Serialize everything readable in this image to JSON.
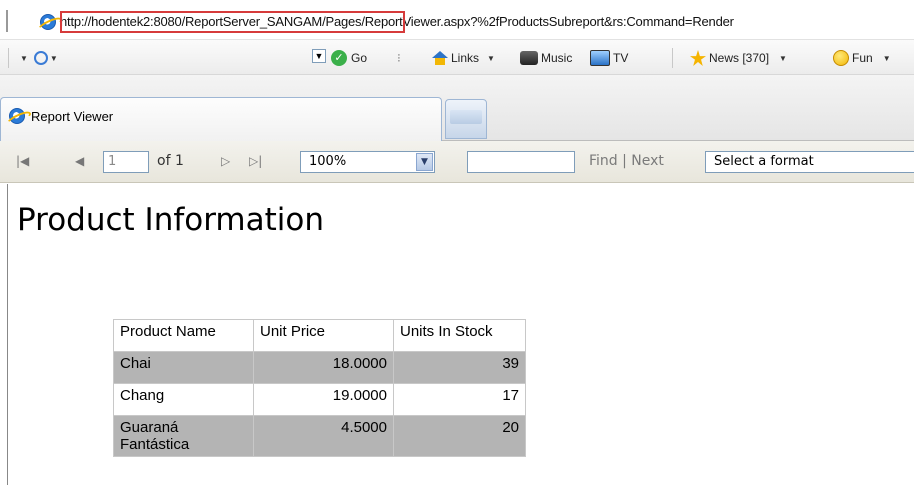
{
  "address_bar": {
    "url": "http://hodentek2:8080/ReportServer_SANGAM/Pages/ReportViewer.aspx?%2fProductsSubreport&rs:Command=Render"
  },
  "links_toolbar": {
    "go": "Go",
    "links": "Links",
    "music": "Music",
    "tv": "TV",
    "news": "News [370]",
    "fun": "Fun"
  },
  "tabs": {
    "active_label": "Report Viewer"
  },
  "report_toolbar": {
    "page_value": "1",
    "of_text": "of 1",
    "zoom_value": "100%",
    "find_value": "",
    "find_label": "Find | Next",
    "format_value": "Select a format"
  },
  "report": {
    "title": "Product Information",
    "table": {
      "headers": [
        "Product Name",
        "Unit Price",
        "Units In Stock"
      ],
      "rows": [
        {
          "name": "Chai",
          "price": "18.0000",
          "stock": "39"
        },
        {
          "name": "Chang",
          "price": "19.0000",
          "stock": "17"
        },
        {
          "name": "Guaraná Fantástica",
          "price": "4.5000",
          "stock": "20"
        }
      ]
    }
  }
}
